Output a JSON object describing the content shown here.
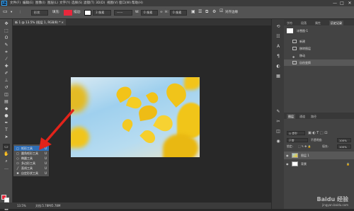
{
  "app": {
    "logo": "Ps"
  },
  "menubar": {
    "items": [
      "文件(F)",
      "编辑(E)",
      "图像(I)",
      "图层(L)",
      "文字(Y)",
      "选择(S)",
      "滤镜(T)",
      "3D(D)",
      "视图(V)",
      "窗口(W)",
      "帮助(H)"
    ],
    "window_buttons": [
      "—",
      "□",
      "✕"
    ]
  },
  "options": {
    "mode": "形状",
    "fill_label": "填充:",
    "stroke_label": "描边:",
    "stroke_width": "3 像素",
    "line_label": "——",
    "w_label": "W:",
    "w_value": "0 像素",
    "h_label": "H:",
    "h_value": "0 像素",
    "align_label": "对齐边缘",
    "fill_color": "#e8283c",
    "stroke_color": "#ffffff"
  },
  "document": {
    "tab_title": "新 1 @ 13.5% (图层 1, RGB/8) *",
    "close": "×"
  },
  "status": {
    "zoom": "13.5%",
    "doc": "文档:5.78M/5.78M"
  },
  "flyout": {
    "items": [
      {
        "icon": "□",
        "label": "矩形工具",
        "key": "U",
        "selected": true
      },
      {
        "icon": "▢",
        "label": "圆角矩形工具",
        "key": "U",
        "selected": false
      },
      {
        "icon": "○",
        "label": "椭圆工具",
        "key": "U",
        "selected": false
      },
      {
        "icon": "⬠",
        "label": "多边形工具",
        "key": "U",
        "selected": false
      },
      {
        "icon": "╱",
        "label": "直线工具",
        "key": "U",
        "selected": false
      },
      {
        "icon": "✱",
        "label": "自定形状工具",
        "key": "U",
        "selected": false
      }
    ]
  },
  "history_panel": {
    "tabs": [
      "字符",
      "段落",
      "属性",
      "历史记录"
    ],
    "snapshot": "冰雪图-1",
    "items": [
      "新建",
      "移除图层",
      "移动",
      "自由变换"
    ]
  },
  "layers_panel": {
    "tabs": [
      "图层",
      "通道",
      "路径"
    ],
    "kind_label": "Q 类型",
    "blend_mode": "正常",
    "opacity_label": "不透明度:",
    "opacity": "100%",
    "lock_label": "锁定:",
    "fill_label": "填充:",
    "fill": "100%",
    "layers": [
      {
        "name": "图层 1",
        "selected": true
      },
      {
        "name": "背景",
        "selected": false
      }
    ]
  },
  "watermark": {
    "text": "Baidu 经验",
    "sub": "jingyan.baidu.com"
  }
}
